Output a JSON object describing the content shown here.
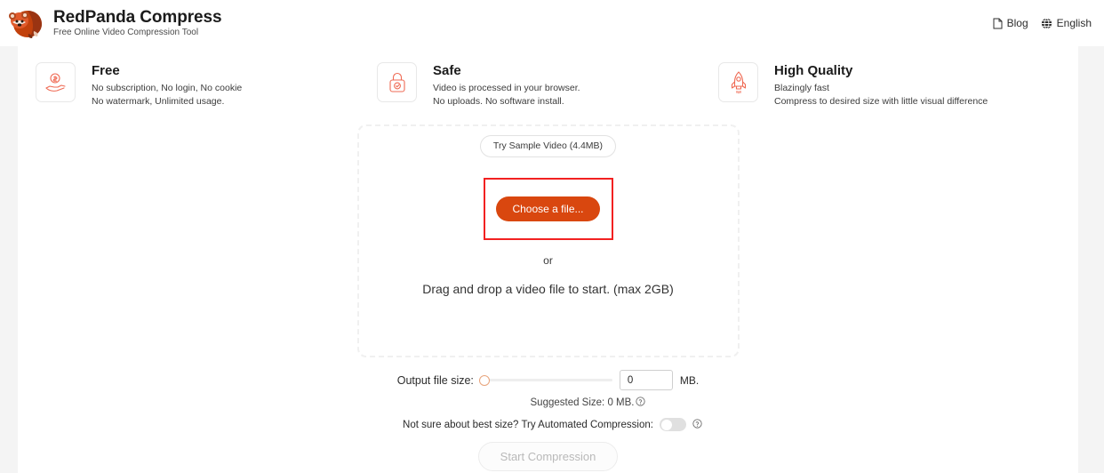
{
  "header": {
    "brand_title": "RedPanda Compress",
    "brand_subtitle": "Free Online Video Compression Tool",
    "logo_icon": "red-panda-logo",
    "links": [
      {
        "label": "Blog",
        "icon": "document-icon"
      },
      {
        "label": "English",
        "icon": "globe-icon"
      }
    ]
  },
  "features": [
    {
      "icon": "hand-coin-icon",
      "title": "Free",
      "line1": "No subscription, No login, No cookie",
      "line2": "No watermark, Unlimited usage."
    },
    {
      "icon": "lock-check-icon",
      "title": "Safe",
      "line1": "Video is processed in your browser.",
      "line2": "No uploads. No software install."
    },
    {
      "icon": "rocket-icon",
      "title": "High Quality",
      "line1": "Blazingly fast",
      "line2": "Compress to desired size with little visual difference"
    }
  ],
  "dropzone": {
    "sample_button": "Try Sample Video (4.4MB)",
    "choose_button": "Choose a file...",
    "or_text": "or",
    "drag_text": "Drag and drop a video file to start. (max 2GB)",
    "highlight_color": "#f22121"
  },
  "settings": {
    "output_size_label": "Output file size:",
    "size_value": "0",
    "size_placeholder": "0",
    "unit_label": "MB.",
    "suggested_size": "Suggested Size: 0 MB.",
    "suggested_help_icon": "question-circle-icon",
    "automated_label": "Not sure about best size? Try Automated Compression:",
    "automated_toggle_state": "off",
    "automated_help_icon": "question-circle-icon",
    "start_button": "Start Compression"
  },
  "colors": {
    "accent": "#d9470f",
    "highlight": "#f22121",
    "page_bg": "#f4f4f4",
    "card_bg": "#ffffff"
  }
}
